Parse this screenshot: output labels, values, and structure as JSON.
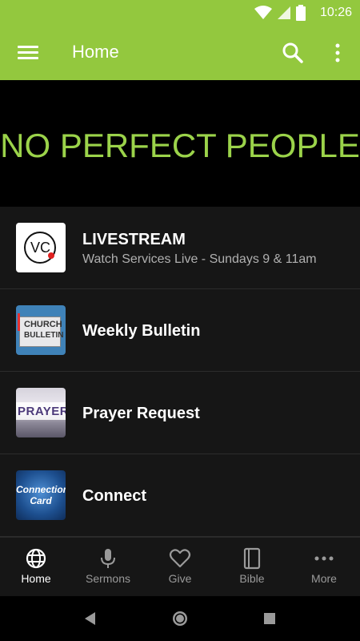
{
  "status_bar": {
    "time": "10:26",
    "icons": [
      "wifi-icon",
      "signal-icon",
      "battery-icon"
    ]
  },
  "app_bar": {
    "title": "Home",
    "icons": [
      "menu-icon",
      "search-icon",
      "more-vert-icon"
    ],
    "color": "#93c83e"
  },
  "banner": {
    "text": "NO PERFECT PEOPLE",
    "text_color": "#9bd34a"
  },
  "list": [
    {
      "title": "LIVESTREAM",
      "subtitle": "Watch Services Live - Sundays 9 & 11am",
      "thumb_text": "VC"
    },
    {
      "title": "Weekly Bulletin",
      "thumb_text_1": "CHURCH",
      "thumb_text_2": "BULLETIN"
    },
    {
      "title": "Prayer Request",
      "thumb_text": "PRAYER"
    },
    {
      "title": "Connect",
      "thumb_text_1": "Connection",
      "thumb_text_2": "Card"
    }
  ],
  "bottom_nav": [
    {
      "label": "Home",
      "icon": "globe-icon",
      "active": true
    },
    {
      "label": "Sermons",
      "icon": "microphone-icon"
    },
    {
      "label": "Give",
      "icon": "heart-icon"
    },
    {
      "label": "Bible",
      "icon": "book-icon"
    },
    {
      "label": "More",
      "icon": "more-horiz-icon"
    }
  ]
}
